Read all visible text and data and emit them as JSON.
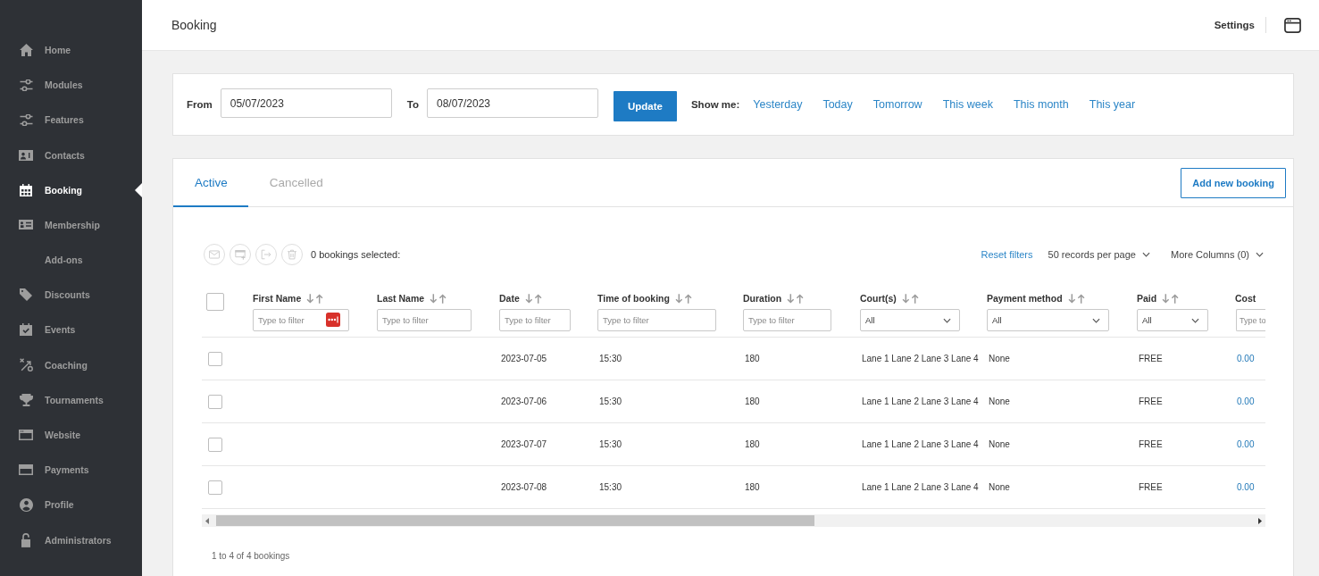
{
  "sidebar": {
    "items": [
      {
        "label": "Home",
        "selected": false
      },
      {
        "label": "Modules",
        "selected": false
      },
      {
        "label": "Features",
        "selected": false
      },
      {
        "label": "Contacts",
        "selected": false
      },
      {
        "label": "Booking",
        "selected": true
      },
      {
        "label": "Membership",
        "selected": false
      },
      {
        "label": "Add-ons",
        "selected": false
      },
      {
        "label": "Discounts",
        "selected": false
      },
      {
        "label": "Events",
        "selected": false
      },
      {
        "label": "Coaching",
        "selected": false
      },
      {
        "label": "Tournaments",
        "selected": false
      },
      {
        "label": "Website",
        "selected": false
      },
      {
        "label": "Payments",
        "selected": false
      },
      {
        "label": "Profile",
        "selected": false
      },
      {
        "label": "Administrators",
        "selected": false
      }
    ]
  },
  "header": {
    "title": "Booking",
    "settings": "Settings"
  },
  "date_filter": {
    "from": {
      "label": "From",
      "value": "05/07/2023"
    },
    "to": {
      "label": "To",
      "value": "08/07/2023"
    },
    "update_button": "Update",
    "show_me": {
      "label": "Show me:",
      "links": [
        "Yesterday",
        "Today",
        "Tomorrow",
        "This week",
        "This month",
        "This year"
      ]
    }
  },
  "bookings": {
    "tabs": [
      {
        "label": "Active",
        "selected": true
      },
      {
        "label": "Cancelled",
        "selected": false
      }
    ],
    "add_button": "Add new booking",
    "toolbar": {
      "actions": [
        {
          "disabled": true
        },
        {
          "disabled": true
        },
        {
          "disabled": true
        },
        {
          "disabled": true
        }
      ],
      "selected_count": "0 bookings selected:",
      "reset_filters": "Reset filters",
      "per_page": "50 records per page",
      "more_columns": "More Columns (0)"
    },
    "table": {
      "select_all": {
        "checked": false
      },
      "columns": [
        {
          "label": "First Name",
          "sortable": true,
          "filter": {
            "kind": "text",
            "placeholder": "Type to filter",
            "extension_icon": true
          }
        },
        {
          "label": "Last Name",
          "sortable": true,
          "filter": {
            "kind": "text",
            "placeholder": "Type to filter"
          }
        },
        {
          "label": "Date",
          "sortable": true,
          "filter": {
            "kind": "text",
            "placeholder": "Type to filter"
          }
        },
        {
          "label": "Time of booking",
          "sortable": true,
          "filter": {
            "kind": "text",
            "placeholder": "Type to filter"
          }
        },
        {
          "label": "Duration",
          "sortable": true,
          "filter": {
            "kind": "text",
            "placeholder": "Type to filter"
          }
        },
        {
          "label": "Court(s)",
          "sortable": true,
          "filter": {
            "kind": "select",
            "value": "All"
          }
        },
        {
          "label": "Payment method",
          "sortable": true,
          "filter": {
            "kind": "select",
            "value": "All"
          }
        },
        {
          "label": "Paid",
          "sortable": true,
          "filter": {
            "kind": "select",
            "value": "All"
          }
        },
        {
          "label": "Cost",
          "filter": {
            "kind": "text",
            "placeholder": "Type to"
          }
        }
      ],
      "rows": [
        {
          "checked": false,
          "date": "2023-07-05",
          "time": "15:30",
          "duration": "180",
          "courts": "Lane 1 Lane 2 Lane 3 Lane 4",
          "payment_method": "None",
          "paid": "FREE",
          "cost": "0.00"
        },
        {
          "checked": false,
          "date": "2023-07-06",
          "time": "15:30",
          "duration": "180",
          "courts": "Lane 1 Lane 2 Lane 3 Lane 4",
          "payment_method": "None",
          "paid": "FREE",
          "cost": "0.00"
        },
        {
          "checked": false,
          "date": "2023-07-07",
          "time": "15:30",
          "duration": "180",
          "courts": "Lane 1 Lane 2 Lane 3 Lane 4",
          "payment_method": "None",
          "paid": "FREE",
          "cost": "0.00"
        },
        {
          "checked": false,
          "date": "2023-07-08",
          "time": "15:30",
          "duration": "180",
          "courts": "Lane 1 Lane 2 Lane 3 Lane 4",
          "payment_method": "None",
          "paid": "FREE",
          "cost": "0.00"
        }
      ]
    },
    "footer": "1 to 4 of 4 bookings"
  }
}
